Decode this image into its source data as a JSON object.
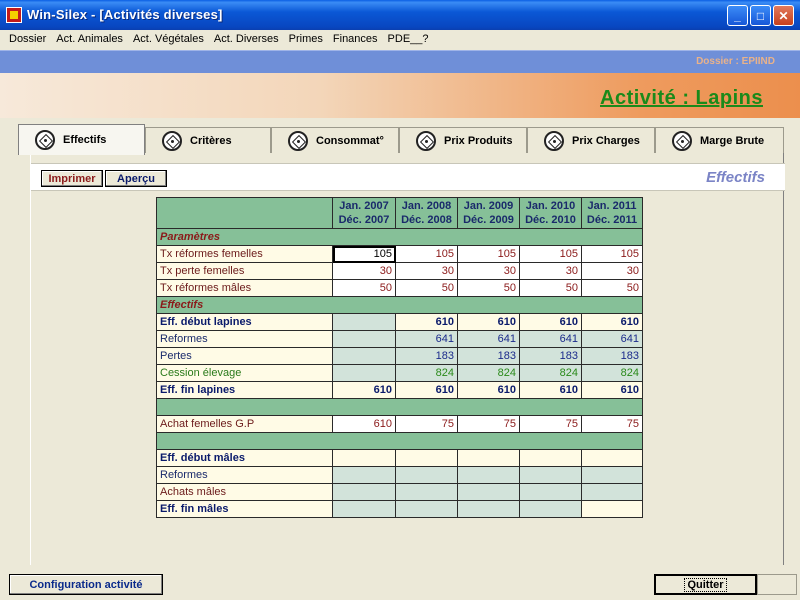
{
  "window": {
    "title": "Win-Silex - [Activités diverses]",
    "buttons": {
      "minimize": "_",
      "maximize": "□",
      "close": "✕"
    }
  },
  "menu": [
    "Dossier",
    "Act. Animales",
    "Act. Végétales",
    "Act. Diverses",
    "Primes",
    "Finances",
    "PDE__?"
  ],
  "header": {
    "dossier": "Dossier : EPIIND",
    "activity_title": "Activité : Lapins"
  },
  "tabs": [
    {
      "label": "Effectifs",
      "active": true
    },
    {
      "label": "Critères"
    },
    {
      "label": "Consommat°"
    },
    {
      "label": "Prix Produits"
    },
    {
      "label": "Prix Charges"
    },
    {
      "label": "Marge Brute"
    }
  ],
  "toolbar": {
    "print_label": "Imprimer",
    "preview_label": "Aperçu",
    "section_title": "Effectifs"
  },
  "grid": {
    "columns": [
      {
        "line1": "Jan. 2007",
        "line2": "Déc. 2007"
      },
      {
        "line1": "Jan. 2008",
        "line2": "Déc. 2008"
      },
      {
        "line1": "Jan. 2009",
        "line2": "Déc. 2009"
      },
      {
        "line1": "Jan. 2010",
        "line2": "Déc. 2010"
      },
      {
        "line1": "Jan. 2011",
        "line2": "Déc. 2011"
      }
    ],
    "sections": {
      "parametres": "Paramètres",
      "effectifs": "Effectifs"
    },
    "rows": {
      "tx_ref_fem": {
        "label": "Tx réformes femelles",
        "values": [
          "105",
          "105",
          "105",
          "105",
          "105"
        ]
      },
      "tx_perte_fem": {
        "label": "Tx perte  femelles",
        "values": [
          "30",
          "30",
          "30",
          "30",
          "30"
        ]
      },
      "tx_ref_males": {
        "label": "Tx réformes mâles",
        "values": [
          "50",
          "50",
          "50",
          "50",
          "50"
        ]
      },
      "eff_debut_lapines": {
        "label": "Eff. début lapines",
        "values": [
          "",
          "610",
          "610",
          "610",
          "610"
        ]
      },
      "reformes": {
        "label": "Reformes",
        "values": [
          "",
          "641",
          "641",
          "641",
          "641"
        ]
      },
      "pertes": {
        "label": "Pertes",
        "values": [
          "",
          "183",
          "183",
          "183",
          "183"
        ]
      },
      "cession": {
        "label": "Cession élevage",
        "values": [
          "",
          "824",
          "824",
          "824",
          "824"
        ]
      },
      "eff_fin_lapines": {
        "label": "Eff. fin  lapines",
        "values": [
          "610",
          "610",
          "610",
          "610",
          "610"
        ]
      },
      "achat_fem": {
        "label": "Achat femelles G.P",
        "values": [
          "610",
          "75",
          "75",
          "75",
          "75"
        ]
      },
      "eff_debut_males": {
        "label": "Eff. début mâles",
        "values": [
          "",
          "",
          "",
          "",
          ""
        ]
      },
      "reformes_males": {
        "label": "Reformes",
        "values": [
          "",
          "",
          "",
          "",
          ""
        ]
      },
      "achats_males": {
        "label": "Achats  mâles",
        "values": [
          "",
          "",
          "",
          "",
          ""
        ]
      },
      "eff_fin_males": {
        "label": "Eff. fin mâles",
        "values": [
          "",
          "",
          "",
          "",
          ""
        ]
      }
    }
  },
  "footer": {
    "config_label": "Configuration activité",
    "quit_label": "Quitter"
  }
}
